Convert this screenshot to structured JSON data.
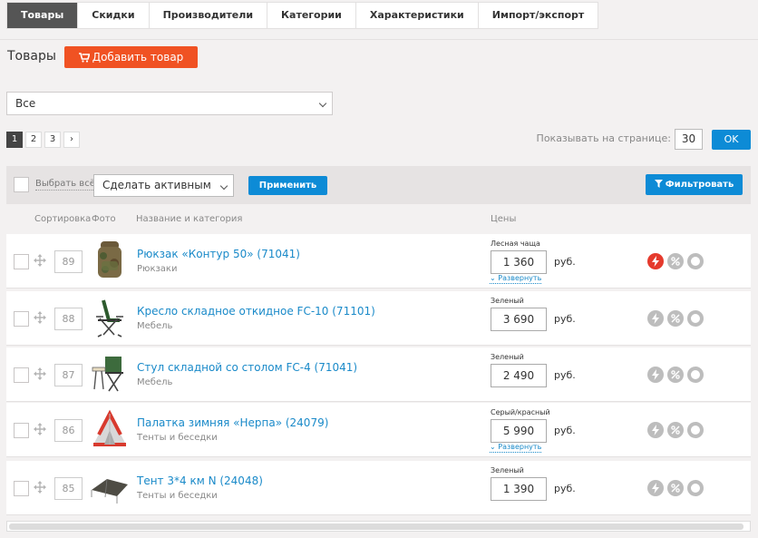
{
  "tabs": [
    "Товары",
    "Скидки",
    "Производители",
    "Категории",
    "Характеристики",
    "Импорт/экспорт"
  ],
  "header": {
    "title": "Товары",
    "add_button": "Добавить товар"
  },
  "category_select": {
    "value": "Все"
  },
  "pagination": {
    "pages": [
      "1",
      "2",
      "3",
      "›"
    ],
    "current": "1"
  },
  "per_page": {
    "label": "Показывать на странице:",
    "value": "30",
    "ok": "OK"
  },
  "toolbar": {
    "select_all": "Выбрать всё",
    "action": "Сделать активным",
    "apply": "Применить",
    "filter": "Фильтровать"
  },
  "columns": {
    "sort": "Сортировка",
    "photo": "Фото",
    "name": "Название и категория",
    "prices": "Цены"
  },
  "currency": "руб.",
  "expand_label": "⌄ Развернуть",
  "colors": {
    "accent": "#f05223",
    "primary": "#0d8bd6",
    "link": "#1a8ac9",
    "active_icon": "#e53a2d"
  },
  "products": [
    {
      "position": "89",
      "name": "Рюкзак «Контур 50» (71041)",
      "category": "Рюкзаки",
      "variant": "Лесная чаща",
      "price": "1 360",
      "expandable": true,
      "icon": "backpack",
      "featured": true
    },
    {
      "position": "88",
      "name": "Кресло складное откидное FC-10 (71101)",
      "category": "Мебель",
      "variant": "Зеленый",
      "price": "3 690",
      "expandable": false,
      "icon": "folding-chair",
      "featured": false
    },
    {
      "position": "87",
      "name": "Стул складной со столом FC-4 (71041)",
      "category": "Мебель",
      "variant": "Зеленый",
      "price": "2 490",
      "expandable": false,
      "icon": "chair-with-table",
      "featured": false
    },
    {
      "position": "86",
      "name": "Палатка зимняя «Нерпа» (24079)",
      "category": "Тенты и беседки",
      "variant": "Серый/красный",
      "price": "5 990",
      "expandable": true,
      "icon": "winter-tent",
      "featured": false
    },
    {
      "position": "85",
      "name": "Тент 3*4 км N (24048)",
      "category": "Тенты и беседки",
      "variant": "Зеленый",
      "price": "1 390",
      "expandable": false,
      "icon": "awning",
      "featured": false
    }
  ]
}
